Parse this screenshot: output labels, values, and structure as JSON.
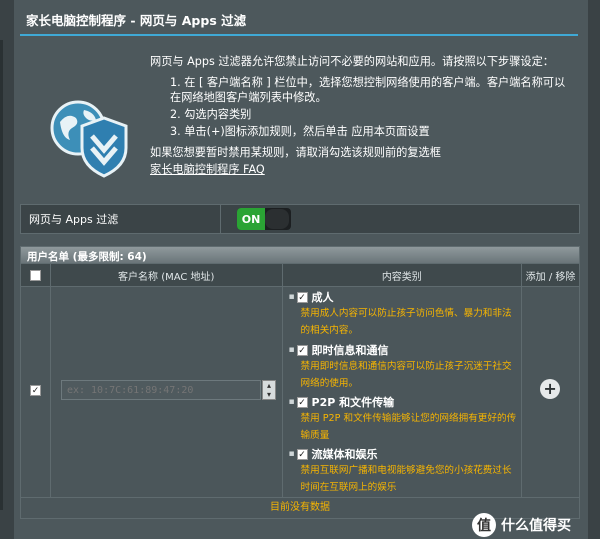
{
  "header": {
    "title": "家长电脑控制程序 - 网页与 Apps 过滤"
  },
  "intro": {
    "description": "网页与 Apps 过滤器允许您禁止访问不必要的网站和应用。请按照以下步骤设定：",
    "steps": [
      "1. 在 [ 客户端名称 ] 栏位中，选择您想控制网络使用的客户端。客户端名称可以在网络地图客户端列表中修改。",
      "2. 勾选内容类别",
      "3. 单击(+)图标添加规则，然后单击 应用本页面设置"
    ],
    "note": "如果您想要暂时禁用某规则，请取消勾选该规则前的复选框",
    "faq_link": "家长电脑控制程序 FAQ"
  },
  "filter_toggle": {
    "label": "网页与 Apps 过滤",
    "state": "ON"
  },
  "client_list": {
    "header": "用户名单 (最多限制: 64)",
    "columns": {
      "name": "客户名称 (MAC 地址)",
      "category": "内容类别",
      "action": "添加 / 移除"
    },
    "mac_placeholder": "ex: 10:7C:61:89:47:20",
    "categories": [
      {
        "title": "成人",
        "desc": "禁用成人内容可以防止孩子访问色情、暴力和非法的相关内容。"
      },
      {
        "title": "即时信息和通信",
        "desc": "禁用即时信息和通信内容可以防止孩子沉迷于社交网络的使用。"
      },
      {
        "title": "P2P 和文件传输",
        "desc": "禁用 P2P 和文件传输能够让您的网络拥有更好的传输质量"
      },
      {
        "title": "流媒体和娱乐",
        "desc": "禁用互联网广播和电视能够避免您的小孩花费过长时间在互联网上的娱乐"
      }
    ],
    "empty_text": "目前没有数据"
  },
  "watermark": {
    "text": "什么值得买",
    "badge": "值"
  },
  "colors": {
    "accent": "#3fa9d6",
    "on_green": "#2aa334",
    "warning": "#f7b500",
    "panel": "#4d585c"
  }
}
